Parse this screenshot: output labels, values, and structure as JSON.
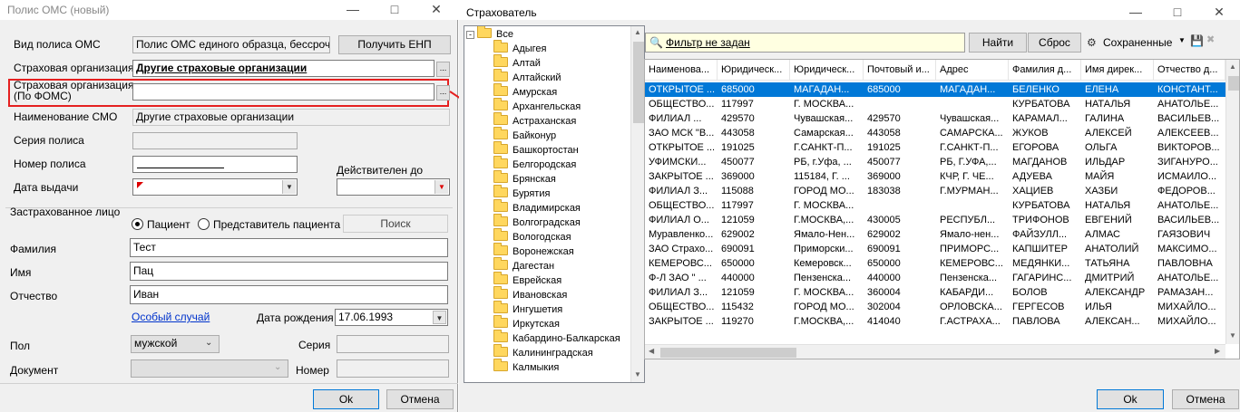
{
  "left_window": {
    "title": "Полис ОМС (новый)",
    "policy_type_label": "Вид полиса ОМС",
    "policy_type_value": "Полис ОМС единого образца, бессроч",
    "get_enp_button": "Получить ЕНП",
    "insurer_label": "Страховая организация",
    "insurer_value": "Другие страховые организации",
    "insurer_foms_label_line1": "Страховая  организация",
    "insurer_foms_label_line2": "(По ФОМС)",
    "smo_name_label": "Наименование СМО",
    "smo_name_value": "Другие страховые организации",
    "series_label": "Серия полиса",
    "number_label": "Номер полиса",
    "valid_until_label": "Действителен до",
    "issue_date_label": "Дата выдачи",
    "insured_group_label": "Застрахованное лицо",
    "radio_patient": "Пациент",
    "radio_representative": "Представитель пациента",
    "search_button": "Поиск",
    "surname_label": "Фамилия",
    "surname_value": "Тест",
    "name_label": "Имя",
    "name_value": "Пац",
    "patronymic_label": "Отчество",
    "patronymic_value": "Иван",
    "special_case_link": "Особый случай",
    "birth_date_label": "Дата рождения",
    "birth_date_value": "17.06.1993",
    "sex_label": "Пол",
    "sex_value": "мужской",
    "doc_series_label": "Серия",
    "document_label": "Документ",
    "doc_number_label": "Номер",
    "ok_button": "Ok",
    "cancel_button": "Отмена"
  },
  "right_window": {
    "title": "Страхователь",
    "tree_root": "Все",
    "tree_items": [
      "Адыгея",
      "Алтай",
      "Алтайский",
      "Амурская",
      "Архангельская",
      "Астраханская",
      "Байконур",
      "Башкортостан",
      "Белгородская",
      "Брянская",
      "Бурятия",
      "Владимирская",
      "Волгоградская",
      "Вологодская",
      "Воронежская",
      "Дагестан",
      "Еврейская",
      "Ивановская",
      "Ингушетия",
      "Иркутская",
      "Кабардино-Балкарская",
      "Калининградская",
      "Калмыкия"
    ],
    "filter_text": "Фильтр не задан",
    "find_button": "Найти",
    "reset_button": "Сброс",
    "saved_button": "Сохраненные",
    "columns": [
      "Наименова...",
      "Юридическ...",
      "Юридическ...",
      "Почтовый и...",
      "Адрес",
      "Фамилия д...",
      "Имя дирек...",
      "Отчество д..."
    ],
    "rows": [
      [
        "ОТКРЫТОЕ ...",
        "685000",
        "МАГАДАН...",
        "685000",
        "МАГАДАН...",
        "БЕЛЕНКО",
        "ЕЛЕНА",
        "КОНСТАНТ..."
      ],
      [
        "ОБЩЕСТВО...",
        "117997",
        "Г. МОСКВА...",
        "",
        "",
        "КУРБАТОВА",
        "НАТАЛЬЯ",
        "АНАТОЛЬЕ..."
      ],
      [
        "ФИЛИАЛ ...",
        "429570",
        "Чувашская...",
        "429570",
        "Чувашская...",
        "КАРАМАЛ...",
        "ГАЛИНА",
        "ВАСИЛЬЕВ..."
      ],
      [
        "ЗАО МСК \"В...",
        "443058",
        "Самарская...",
        "443058",
        "САМАРСКА...",
        "ЖУКОВ",
        "АЛЕКСЕЙ",
        "АЛЕКСЕЕВ..."
      ],
      [
        "ОТКРЫТОЕ ...",
        "191025",
        "Г.САНКТ-П...",
        "191025",
        "Г.САНКТ-П...",
        "ЕГОРОВА",
        "ОЛЬГА",
        "ВИКТОРОВ..."
      ],
      [
        "УФИМСКИ...",
        "450077",
        "РБ, г.Уфа, ...",
        "450077",
        "РБ, Г.УФА,...",
        "МАГДАНОВ",
        "ИЛЬДАР",
        "ЗИГАНУРО..."
      ],
      [
        "ЗАКРЫТОЕ ...",
        "369000",
        "115184, Г. ...",
        "369000",
        "КЧР, Г. ЧЕ...",
        "АДУЕВА",
        "МАЙЯ",
        "ИСМАИЛО..."
      ],
      [
        "ФИЛИАЛ З...",
        "115088",
        "ГОРОД МО...",
        "183038",
        "Г.МУРМАН...",
        "ХАЦИЕВ",
        "ХАЗБИ",
        "ФЕДОРОВ..."
      ],
      [
        "ОБЩЕСТВО...",
        "117997",
        "Г. МОСКВА...",
        "",
        "",
        "КУРБАТОВА",
        "НАТАЛЬЯ",
        "АНАТОЛЬЕ..."
      ],
      [
        "ФИЛИАЛ О...",
        "121059",
        "Г.МОСКВА,...",
        "430005",
        "РЕСПУБЛ...",
        "ТРИФОНОВ",
        "ЕВГЕНИЙ",
        "ВАСИЛЬЕВ..."
      ],
      [
        "Муравленко...",
        "629002",
        "Ямало-Нен...",
        "629002",
        "Ямало-нен...",
        "ФАЙЗУЛЛ...",
        "АЛМАС",
        "ГАЯЗОВИЧ"
      ],
      [
        "ЗАО Страхо...",
        "690091",
        "Приморски...",
        "690091",
        "ПРИМОРС...",
        "КАПШИТЕР",
        "АНАТОЛИЙ",
        "МАКСИМО..."
      ],
      [
        "КЕМЕРОВС...",
        "650000",
        "Кемеровск...",
        "650000",
        "КЕМЕРОВС...",
        "МЕДЯНКИ...",
        "ТАТЬЯНА",
        "ПАВЛОВНА"
      ],
      [
        "Ф-Л ЗАО \" ...",
        "440000",
        "Пензенска...",
        "440000",
        "Пензенска...",
        "ГАГАРИНС...",
        "ДМИТРИЙ",
        "АНАТОЛЬЕ..."
      ],
      [
        "ФИЛИАЛ З...",
        "121059",
        "Г. МОСКВА...",
        "360004",
        "КАБАРДИ...",
        "БОЛОВ",
        "АЛЕКСАНДР",
        "РАМАЗАН..."
      ],
      [
        "ОБЩЕСТВО...",
        "115432",
        "ГОРОД МО...",
        "302004",
        "ОРЛОВСКА...",
        "ГЕРГЕСОВ",
        "ИЛЬЯ",
        "МИХАЙЛО..."
      ],
      [
        "ЗАКРЫТОЕ ...",
        "119270",
        "Г.МОСКВА,...",
        "414040",
        "Г.АСТРАХА...",
        "ПАВЛОВА",
        "АЛЕКСАН...",
        "МИХАЙЛО..."
      ]
    ],
    "ok_button": "Ok",
    "cancel_button": "Отмена"
  },
  "colors": {
    "selection": "#0078d7",
    "highlight_box": "#e52020",
    "filter_bg": "#ffffe1"
  }
}
